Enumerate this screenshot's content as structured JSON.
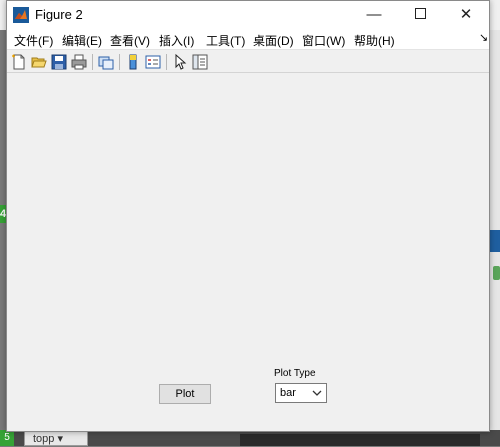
{
  "window": {
    "title": "Figure 2",
    "controls": {
      "minimize": "—",
      "close": "✕"
    }
  },
  "menubar": {
    "items": [
      {
        "label": "文件(F)"
      },
      {
        "label": "编辑(E)"
      },
      {
        "label": "查看(V)"
      },
      {
        "label": "插入(I)"
      },
      {
        "label": "工具(T)"
      },
      {
        "label": "桌面(D)"
      },
      {
        "label": "窗口(W)"
      },
      {
        "label": "帮助(H)"
      }
    ],
    "overflow": "↘"
  },
  "toolbar": {
    "icons": [
      "new-figure-icon",
      "open-file-icon",
      "save-icon",
      "print-icon",
      "link-figure-icon",
      "colorbar-icon",
      "legend-icon",
      "edit-plot-icon",
      "property-inspector-icon"
    ]
  },
  "figure": {
    "plot_button_label": "Plot",
    "plot_type_label": "Plot Type",
    "plot_type_value": "bar"
  },
  "background": {
    "taskbar_tab": "topp ▾",
    "left_marker": "4",
    "bottom_marker": "5"
  }
}
